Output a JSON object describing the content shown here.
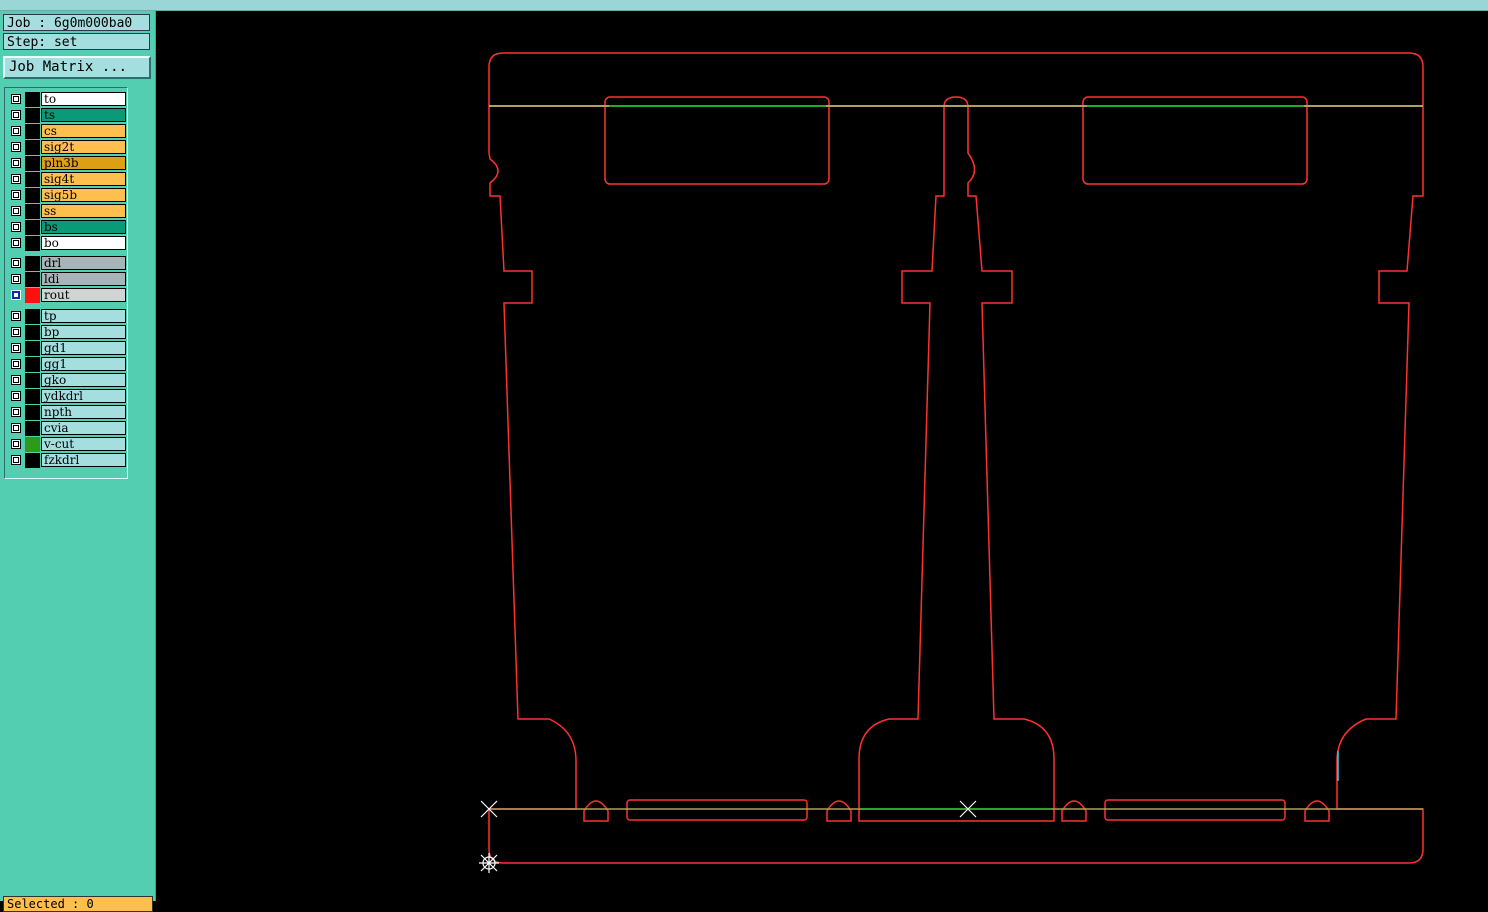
{
  "job": {
    "label": "Job : 6g0m000ba0"
  },
  "step": {
    "label": "Step: set"
  },
  "job_matrix": {
    "label": "Job Matrix ..."
  },
  "layer_groups": [
    [
      {
        "name": "to",
        "color": "#ffffff",
        "swatch": "#000000",
        "checked": false
      },
      {
        "name": "ts",
        "color": "#0a9a78",
        "swatch": "#000000",
        "checked": false
      },
      {
        "name": "cs",
        "color": "#ffbf4f",
        "swatch": "#000000",
        "checked": false
      },
      {
        "name": "sig2t",
        "color": "#ffbf4f",
        "swatch": "#000000",
        "checked": false
      },
      {
        "name": "pln3b",
        "color": "#dca015",
        "swatch": "#000000",
        "checked": false
      },
      {
        "name": "sig4t",
        "color": "#ffbf4f",
        "swatch": "#000000",
        "checked": false
      },
      {
        "name": "sig5b",
        "color": "#ffbf4f",
        "swatch": "#000000",
        "checked": false
      },
      {
        "name": "ss",
        "color": "#ffbf4f",
        "swatch": "#000000",
        "checked": false
      },
      {
        "name": "bs",
        "color": "#0a9a78",
        "swatch": "#000000",
        "checked": false
      },
      {
        "name": "bo",
        "color": "#ffffff",
        "swatch": "#000000",
        "checked": false
      }
    ],
    [
      {
        "name": "drl",
        "color": "#a9b4b8",
        "swatch": "#000000",
        "checked": false
      },
      {
        "name": "ldi",
        "color": "#a9b4b8",
        "swatch": "#000000",
        "checked": false
      },
      {
        "name": "rout",
        "color": "#d0d4d4",
        "swatch": "#ff1010",
        "checked": true
      }
    ],
    [
      {
        "name": "tp",
        "color": "#a4dede",
        "swatch": "#000000",
        "checked": false
      },
      {
        "name": "bp",
        "color": "#a4dede",
        "swatch": "#000000",
        "checked": false
      },
      {
        "name": "gd1",
        "color": "#a4dede",
        "swatch": "#000000",
        "checked": false
      },
      {
        "name": "gg1",
        "color": "#a4dede",
        "swatch": "#000000",
        "checked": false
      },
      {
        "name": "gko",
        "color": "#a4dede",
        "swatch": "#000000",
        "checked": false
      },
      {
        "name": "ydkdrl",
        "color": "#a4dede",
        "swatch": "#000000",
        "checked": false
      },
      {
        "name": "npth",
        "color": "#a4dede",
        "swatch": "#000000",
        "checked": false
      },
      {
        "name": "cvia",
        "color": "#a4dede",
        "swatch": "#000000",
        "checked": false
      },
      {
        "name": "v-cut",
        "color": "#a4dede",
        "swatch": "#2e9a1a",
        "checked": false
      },
      {
        "name": "fzkdrl",
        "color": "#a4dede",
        "swatch": "#000000",
        "checked": false
      }
    ]
  ],
  "status": {
    "label": "Selected : 0"
  },
  "colors": {
    "outline": "#ff3030",
    "vcut": "#22aa22",
    "scoreline": "#b0a060",
    "panel_bg": "#54ceb0"
  }
}
